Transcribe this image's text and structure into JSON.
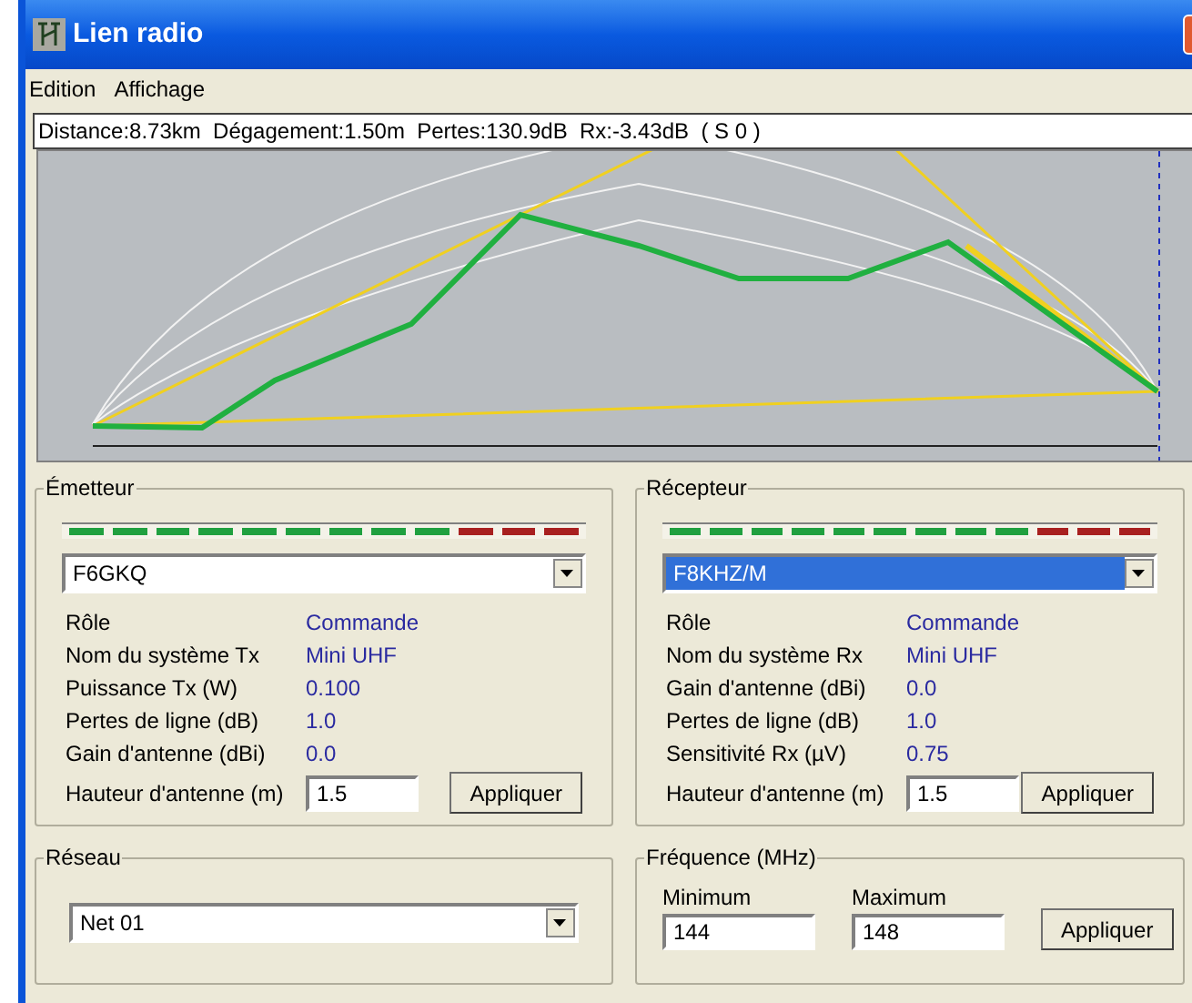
{
  "window": {
    "title": "Lien radio"
  },
  "menu": [
    {
      "label": "Edition"
    },
    {
      "label": "Affichage"
    }
  ],
  "status": "Distance:8.73km  Dégagement:1.50m  Pertes:130.9dB  Rx:-3.43dB  ( S 0 )",
  "transmitter": {
    "title": "Émetteur",
    "station": "F6GKQ",
    "highlighted": false,
    "fields": [
      {
        "label": "Rôle",
        "value": "Commande"
      },
      {
        "label": "Nom du système Tx",
        "value": "Mini UHF"
      },
      {
        "label": "Puissance Tx (W)",
        "value": "0.100"
      },
      {
        "label": "Pertes de ligne (dB)",
        "value": "1.0"
      },
      {
        "label": "Gain d'antenne (dBi)",
        "value": "0.0"
      }
    ],
    "height_label": "Hauteur d'antenne (m)",
    "height_value": "1.5",
    "apply": "Appliquer"
  },
  "receiver": {
    "title": "Récepteur",
    "station": "F8KHZ/M",
    "highlighted": true,
    "fields": [
      {
        "label": "Rôle",
        "value": "Commande"
      },
      {
        "label": "Nom du système Rx",
        "value": "Mini UHF"
      },
      {
        "label": "Gain d'antenne (dBi)",
        "value": "0.0"
      },
      {
        "label": "Pertes de ligne (dB)",
        "value": "1.0"
      },
      {
        "label": "Sensitivité Rx (µV)",
        "value": "0.75"
      }
    ],
    "height_label": "Hauteur d'antenne (m)",
    "height_value": "1.5",
    "apply": "Appliquer"
  },
  "network": {
    "title": "Réseau",
    "value": "Net 01"
  },
  "frequency": {
    "title": "Fréquence (MHz)",
    "min_label": "Minimum",
    "min_value": "144",
    "max_label": "Maximum",
    "max_value": "148",
    "apply": "Appliquer"
  }
}
